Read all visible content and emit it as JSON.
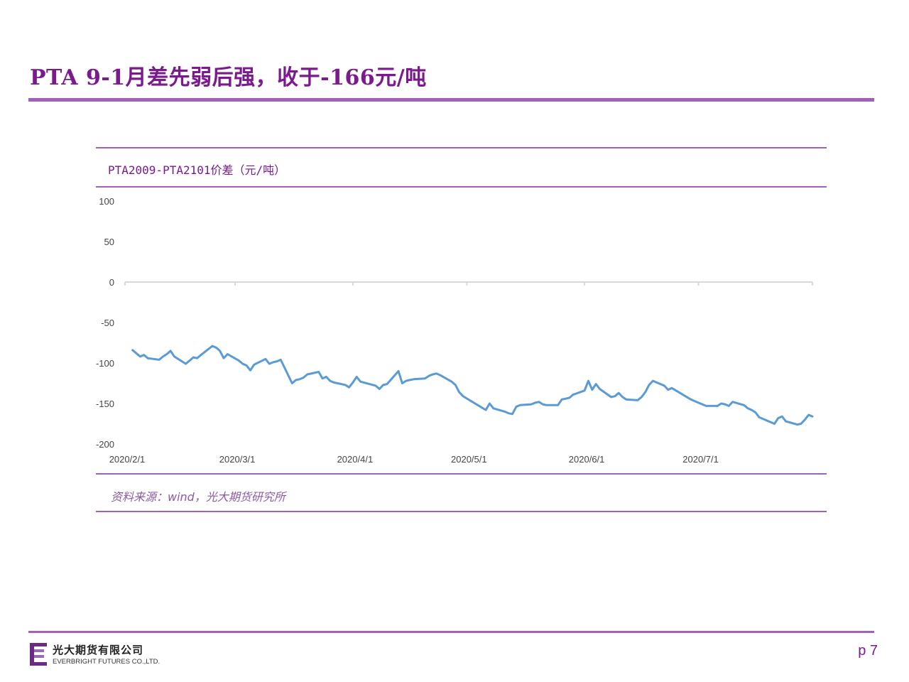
{
  "slide": {
    "title": "PTA 9-1月差先弱后强，收于-166元/吨",
    "page_number": "p 7"
  },
  "chart_title": "PTA2009-PTA2101价差（元/吨）",
  "source": "资料来源：wind，光大期货研究所",
  "footer": {
    "company_cn": "光大期货有限公司",
    "company_en": "EVERBRIGHT FUTURES CO.,LTD."
  },
  "colors": {
    "accent": "#a061b8",
    "title": "#7b1a8e",
    "line": "#5b9bd5"
  },
  "chart_data": {
    "type": "line",
    "title": "PTA2009-PTA2101价差（元/吨）",
    "xlabel": "",
    "ylabel": "",
    "ylim": [
      -200,
      100
    ],
    "yticks": [
      "100",
      "50",
      "0",
      "-50",
      "-100",
      "-150",
      "-200"
    ],
    "ytick_values": [
      100,
      50,
      0,
      -50,
      -100,
      -150,
      -200
    ],
    "xticks": [
      "2020/2/1",
      "2020/3/1",
      "2020/4/1",
      "2020/5/1",
      "2020/6/1",
      "2020/7/1"
    ],
    "xtick_dates": [
      "2020-02-01",
      "2020-03-01",
      "2020-04-01",
      "2020-05-01",
      "2020-06-01",
      "2020-07-01"
    ],
    "xlim": [
      "2020-02-01",
      "2020-07-31"
    ],
    "grid": false,
    "series": [
      {
        "name": "",
        "x": [
          "2020-02-03",
          "2020-02-04",
          "2020-02-05",
          "2020-02-06",
          "2020-02-07",
          "2020-02-10",
          "2020-02-11",
          "2020-02-12",
          "2020-02-13",
          "2020-02-14",
          "2020-02-17",
          "2020-02-18",
          "2020-02-19",
          "2020-02-20",
          "2020-02-21",
          "2020-02-24",
          "2020-02-25",
          "2020-02-26",
          "2020-02-27",
          "2020-02-28",
          "2020-03-02",
          "2020-03-03",
          "2020-03-04",
          "2020-03-05",
          "2020-03-06",
          "2020-03-09",
          "2020-03-10",
          "2020-03-11",
          "2020-03-12",
          "2020-03-13",
          "2020-03-16",
          "2020-03-17",
          "2020-03-18",
          "2020-03-19",
          "2020-03-20",
          "2020-03-23",
          "2020-03-24",
          "2020-03-25",
          "2020-03-26",
          "2020-03-27",
          "2020-03-30",
          "2020-03-31",
          "2020-04-01",
          "2020-04-02",
          "2020-04-03",
          "2020-04-07",
          "2020-04-08",
          "2020-04-09",
          "2020-04-10",
          "2020-04-13",
          "2020-04-14",
          "2020-04-15",
          "2020-04-16",
          "2020-04-17",
          "2020-04-20",
          "2020-04-21",
          "2020-04-22",
          "2020-04-23",
          "2020-04-24",
          "2020-04-27",
          "2020-04-28",
          "2020-04-29",
          "2020-04-30",
          "2020-05-06",
          "2020-05-07",
          "2020-05-08",
          "2020-05-11",
          "2020-05-12",
          "2020-05-13",
          "2020-05-14",
          "2020-05-15",
          "2020-05-18",
          "2020-05-19",
          "2020-05-20",
          "2020-05-21",
          "2020-05-22",
          "2020-05-25",
          "2020-05-26",
          "2020-05-27",
          "2020-05-28",
          "2020-05-29",
          "2020-06-01",
          "2020-06-02",
          "2020-06-03",
          "2020-06-04",
          "2020-06-05",
          "2020-06-08",
          "2020-06-09",
          "2020-06-10",
          "2020-06-11",
          "2020-06-12",
          "2020-06-15",
          "2020-06-16",
          "2020-06-17",
          "2020-06-18",
          "2020-06-19",
          "2020-06-22",
          "2020-06-23",
          "2020-06-24",
          "2020-06-29",
          "2020-06-30",
          "2020-07-01",
          "2020-07-02",
          "2020-07-03",
          "2020-07-06",
          "2020-07-07",
          "2020-07-08",
          "2020-07-09",
          "2020-07-10",
          "2020-07-13",
          "2020-07-14",
          "2020-07-15",
          "2020-07-16",
          "2020-07-17",
          "2020-07-20",
          "2020-07-21",
          "2020-07-22",
          "2020-07-23",
          "2020-07-24",
          "2020-07-27",
          "2020-07-28",
          "2020-07-29",
          "2020-07-30",
          "2020-07-31"
        ],
        "values": [
          -84,
          -88,
          -92,
          -90,
          -94,
          -96,
          -92,
          -89,
          -85,
          -92,
          -101,
          -97,
          -93,
          -94,
          -90,
          -79,
          -81,
          -85,
          -94,
          -89,
          -97,
          -101,
          -103,
          -109,
          -102,
          -95,
          -101,
          -99,
          -98,
          -96,
          -125,
          -121,
          -120,
          -118,
          -114,
          -111,
          -119,
          -117,
          -122,
          -124,
          -127,
          -130,
          -124,
          -117,
          -123,
          -128,
          -132,
          -127,
          -126,
          -110,
          -125,
          -122,
          -121,
          -120,
          -119,
          -116,
          -114,
          -113,
          -115,
          -123,
          -127,
          -136,
          -141,
          -158,
          -150,
          -156,
          -160,
          -162,
          -163,
          -154,
          -152,
          -151,
          -149,
          -148,
          -151,
          -152,
          -152,
          -145,
          -144,
          -143,
          -139,
          -134,
          -122,
          -133,
          -126,
          -132,
          -142,
          -141,
          -137,
          -142,
          -145,
          -146,
          -142,
          -136,
          -127,
          -122,
          -128,
          -133,
          -131,
          -145,
          -147,
          -149,
          -151,
          -153,
          -153,
          -150,
          -151,
          -153,
          -148,
          -152,
          -156,
          -158,
          -161,
          -167,
          -173,
          -175,
          -168,
          -166,
          -172,
          -176,
          -175,
          -170,
          -164,
          -166
        ]
      }
    ]
  }
}
